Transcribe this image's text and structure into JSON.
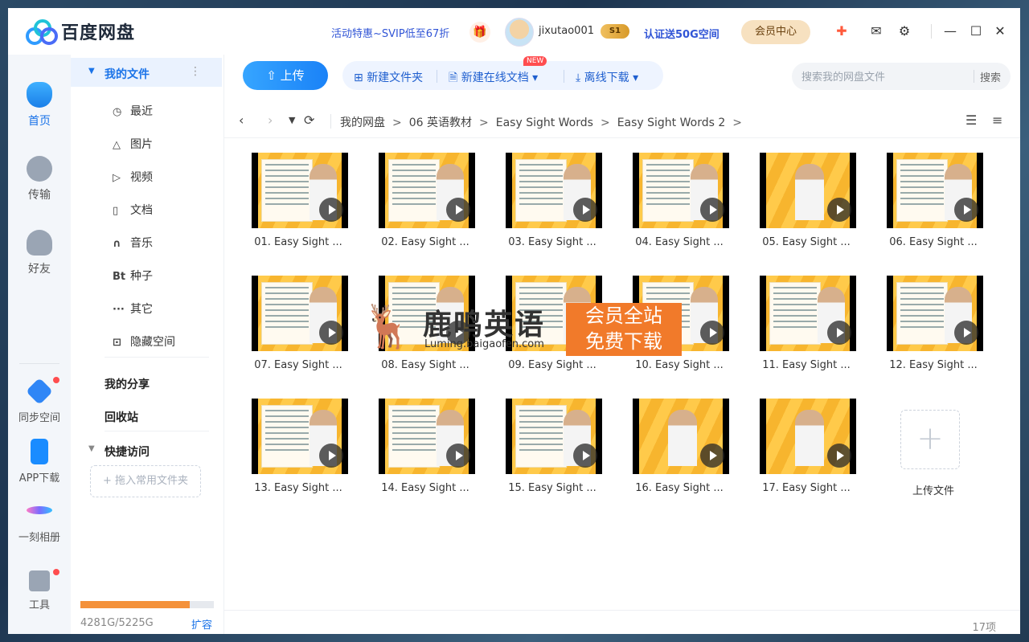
{
  "app": {
    "name": "百度网盘",
    "promo": "活动特惠~SVIP低至67折",
    "username": "jixutao001",
    "vip_badge": "S1",
    "verify": "认证送50G空间",
    "member_center": "会员中心"
  },
  "rail": {
    "items": [
      {
        "label": "首页",
        "icon": "cloud-icon"
      },
      {
        "label": "传输",
        "icon": "transfer-icon"
      },
      {
        "label": "好友",
        "icon": "friends-icon"
      },
      {
        "label": "同步空间",
        "icon": "sync-icon"
      },
      {
        "label": "APP下载",
        "icon": "phone-icon"
      },
      {
        "label": "一刻相册",
        "icon": "album-icon"
      },
      {
        "label": "工具",
        "icon": "tools-icon"
      }
    ]
  },
  "sidebar": {
    "my_files": "我的文件",
    "items": [
      {
        "label": "最近",
        "icon": "clock-icon",
        "glyph": "◷"
      },
      {
        "label": "图片",
        "icon": "image-icon",
        "glyph": "△"
      },
      {
        "label": "视频",
        "icon": "video-icon",
        "glyph": "▷"
      },
      {
        "label": "文档",
        "icon": "document-icon",
        "glyph": "▯"
      },
      {
        "label": "音乐",
        "icon": "headphones-icon",
        "glyph": "∩"
      },
      {
        "label": "种子",
        "icon": "torrent-icon",
        "glyph": "Bt"
      },
      {
        "label": "其它",
        "icon": "more-icon",
        "glyph": "···"
      },
      {
        "label": "隐藏空间",
        "icon": "lock-icon",
        "glyph": "⊡"
      }
    ],
    "my_share": "我的分享",
    "recycle": "回收站",
    "quick_access": "快捷访问",
    "drop_hint": "+ 拖入常用文件夹",
    "quota": "4281G/5225G",
    "quota_fraction": 0.82,
    "expand": "扩容"
  },
  "toolbar": {
    "upload": "上传",
    "new_folder": "新建文件夹",
    "new_doc": "新建在线文档",
    "new_badge": "NEW",
    "offline": "离线下载",
    "search_placeholder": "搜索我的网盘文件",
    "search_btn": "搜索"
  },
  "breadcrumb": [
    "我的网盘",
    "06 英语教材",
    "Easy Sight Words",
    "Easy Sight Words 2"
  ],
  "files": [
    {
      "name": "01. Easy Sight ...",
      "kind": "slide"
    },
    {
      "name": "02. Easy Sight ...",
      "kind": "slide"
    },
    {
      "name": "03. Easy Sight ...",
      "kind": "slide"
    },
    {
      "name": "04. Easy Sight ...",
      "kind": "slide"
    },
    {
      "name": "05. Easy Sight ...",
      "kind": "video"
    },
    {
      "name": "06. Easy Sight ...",
      "kind": "slide"
    },
    {
      "name": "07. Easy Sight ...",
      "kind": "slide"
    },
    {
      "name": "08. Easy Sight ...",
      "kind": "slide"
    },
    {
      "name": "09. Easy Sight ...",
      "kind": "slide"
    },
    {
      "name": "10. Easy Sight ...",
      "kind": "slide"
    },
    {
      "name": "11. Easy Sight ...",
      "kind": "slide"
    },
    {
      "name": "12. Easy Sight ...",
      "kind": "slide"
    },
    {
      "name": "13. Easy Sight ...",
      "kind": "slide"
    },
    {
      "name": "14. Easy Sight ...",
      "kind": "slide"
    },
    {
      "name": "15. Easy Sight ...",
      "kind": "slide"
    },
    {
      "name": "16. Easy Sight ...",
      "kind": "video"
    },
    {
      "name": "17. Easy Sight ...",
      "kind": "video"
    }
  ],
  "upload_tile": "上传文件",
  "item_count": "17项",
  "watermark": {
    "title": "鹿鸣英语",
    "url": "Luming.baigaofen.com",
    "tag_line1": "会员全站",
    "tag_line2": "免费下载"
  },
  "colors": {
    "accent": "#1a73e8",
    "quota": "#f4913a",
    "watermark": "#f17a2a"
  }
}
